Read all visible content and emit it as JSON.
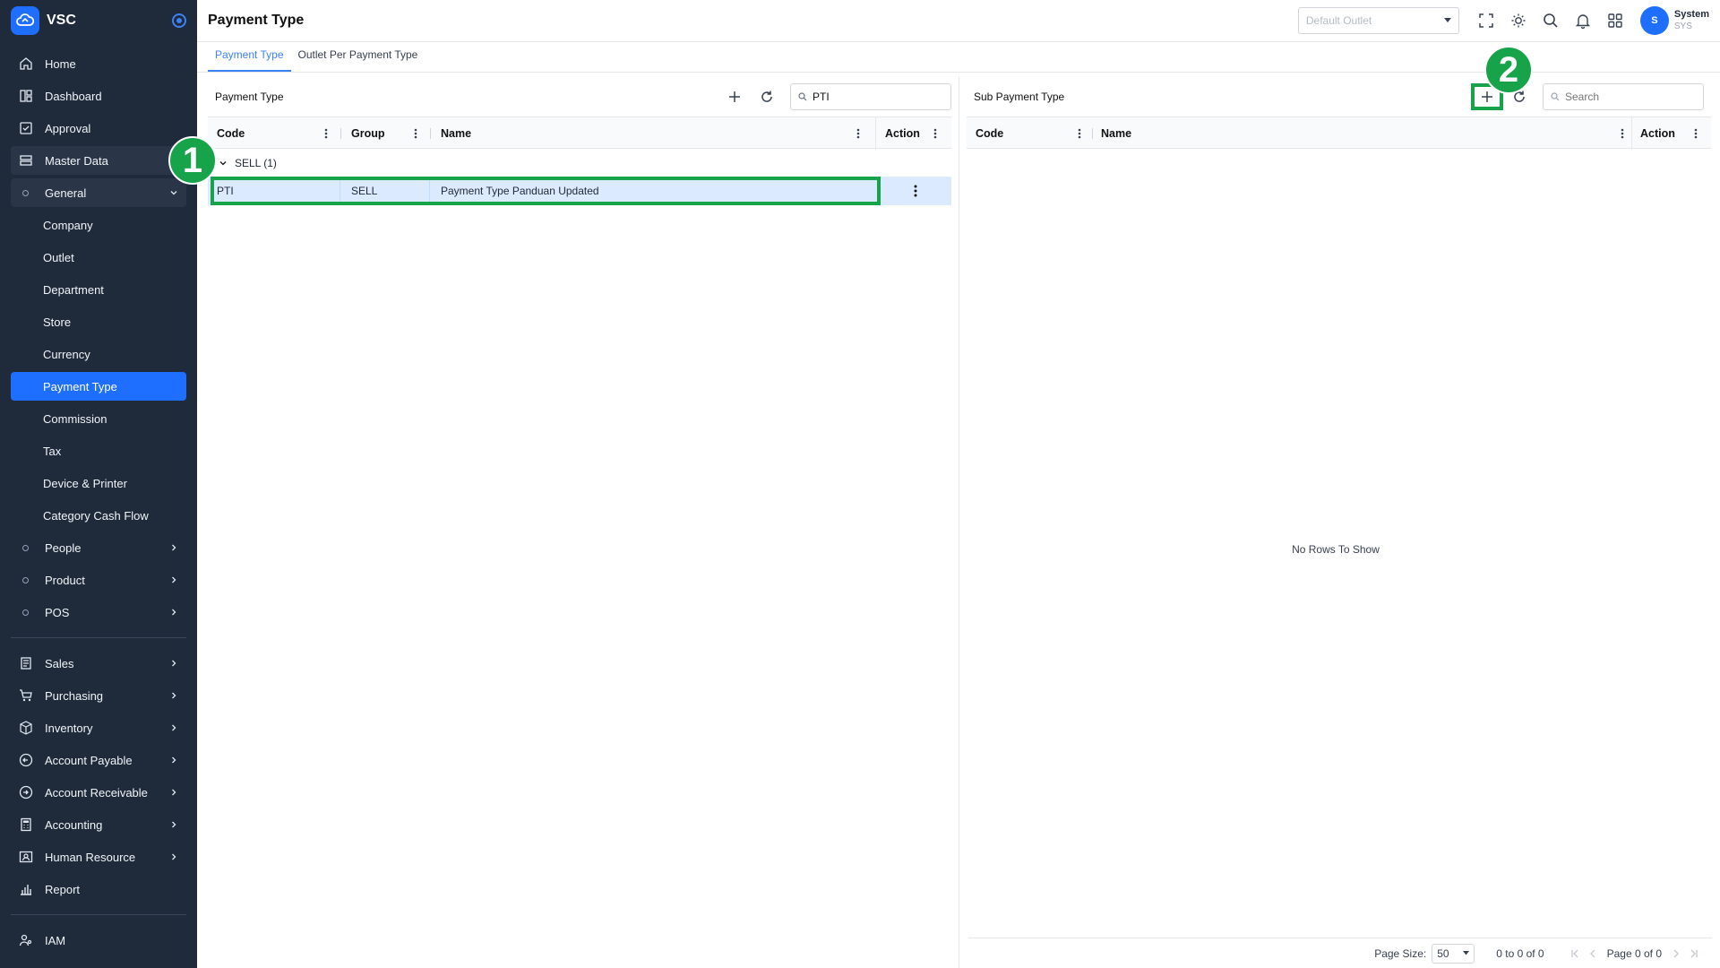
{
  "app": {
    "name": "VSC"
  },
  "sidebar": {
    "items": [
      {
        "label": "Home"
      },
      {
        "label": "Dashboard"
      },
      {
        "label": "Approval"
      },
      {
        "label": "Master Data"
      },
      {
        "label": "General"
      },
      {
        "label": "Company"
      },
      {
        "label": "Outlet"
      },
      {
        "label": "Department"
      },
      {
        "label": "Store"
      },
      {
        "label": "Currency"
      },
      {
        "label": "Payment Type"
      },
      {
        "label": "Commission"
      },
      {
        "label": "Tax"
      },
      {
        "label": "Device & Printer"
      },
      {
        "label": "Category Cash Flow"
      },
      {
        "label": "People"
      },
      {
        "label": "Product"
      },
      {
        "label": "POS"
      },
      {
        "label": "Sales"
      },
      {
        "label": "Purchasing"
      },
      {
        "label": "Inventory"
      },
      {
        "label": "Account Payable"
      },
      {
        "label": "Account Receivable"
      },
      {
        "label": "Accounting"
      },
      {
        "label": "Human Resource"
      },
      {
        "label": "Report"
      },
      {
        "label": "IAM"
      }
    ]
  },
  "header": {
    "title": "Payment Type",
    "outlet_placeholder": "Default Outlet",
    "user_initial": "S",
    "user_name": "System",
    "user_sub": "SYS"
  },
  "tabs": [
    {
      "label": "Payment Type",
      "active": true
    },
    {
      "label": "Outlet Per Payment Type",
      "active": false
    }
  ],
  "left_panel": {
    "title": "Payment Type",
    "search_value": "PTI",
    "columns": [
      "Code",
      "Group",
      "Name",
      "Action"
    ],
    "group_label": "SELL (1)",
    "rows": [
      {
        "code": "PTI",
        "group": "SELL",
        "name": "Payment Type Panduan Updated"
      }
    ]
  },
  "right_panel": {
    "title": "Sub Payment Type",
    "search_placeholder": "Search",
    "columns": [
      "Code",
      "Name",
      "Action"
    ],
    "empty_text": "No Rows To Show",
    "pager": {
      "page_size_label": "Page Size:",
      "page_size": "50",
      "range": "0 to 0 of 0",
      "page": "Page 0 of 0"
    }
  },
  "annotations": {
    "badge1": "1",
    "badge2": "2",
    "color": "#16a34a"
  },
  "colors": {
    "sidebar_bg": "#1f2a3a",
    "accent": "#1e6fff",
    "row_selected": "#dbeafe"
  }
}
